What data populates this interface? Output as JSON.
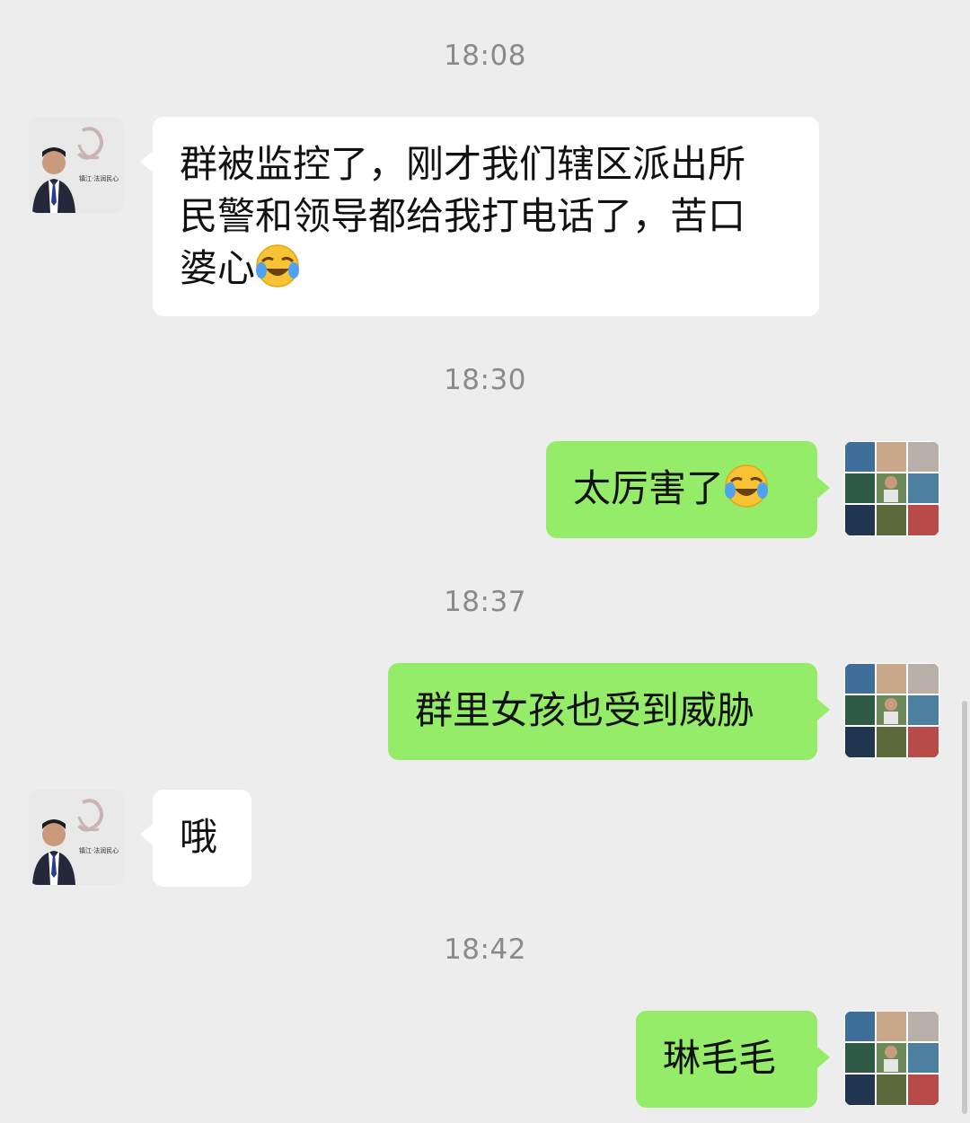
{
  "chat": {
    "timestamps": [
      "18:08",
      "18:30",
      "18:37",
      "18:42"
    ],
    "messages": [
      {
        "sender": "contact",
        "text_lines": [
          "群被监控了，刚才我们辖区派出所",
          "民警和领导都给我打电话了，苦口",
          "婆心"
        ],
        "emoji": "tears-of-joy-emoji"
      },
      {
        "sender": "me",
        "text": "太厉害了",
        "emoji": "tears-of-joy-emoji"
      },
      {
        "sender": "me",
        "text": "群里女孩也受到威胁"
      },
      {
        "sender": "contact",
        "text": "哦"
      },
      {
        "sender": "me",
        "text": "琳毛毛"
      }
    ],
    "contact_avatar": {
      "badge_text": "镇江·法润民心"
    },
    "colors": {
      "background": "#ededed",
      "outgoing_bubble": "#95ec69",
      "incoming_bubble": "#ffffff",
      "timestamp": "#8a8a8a"
    }
  }
}
